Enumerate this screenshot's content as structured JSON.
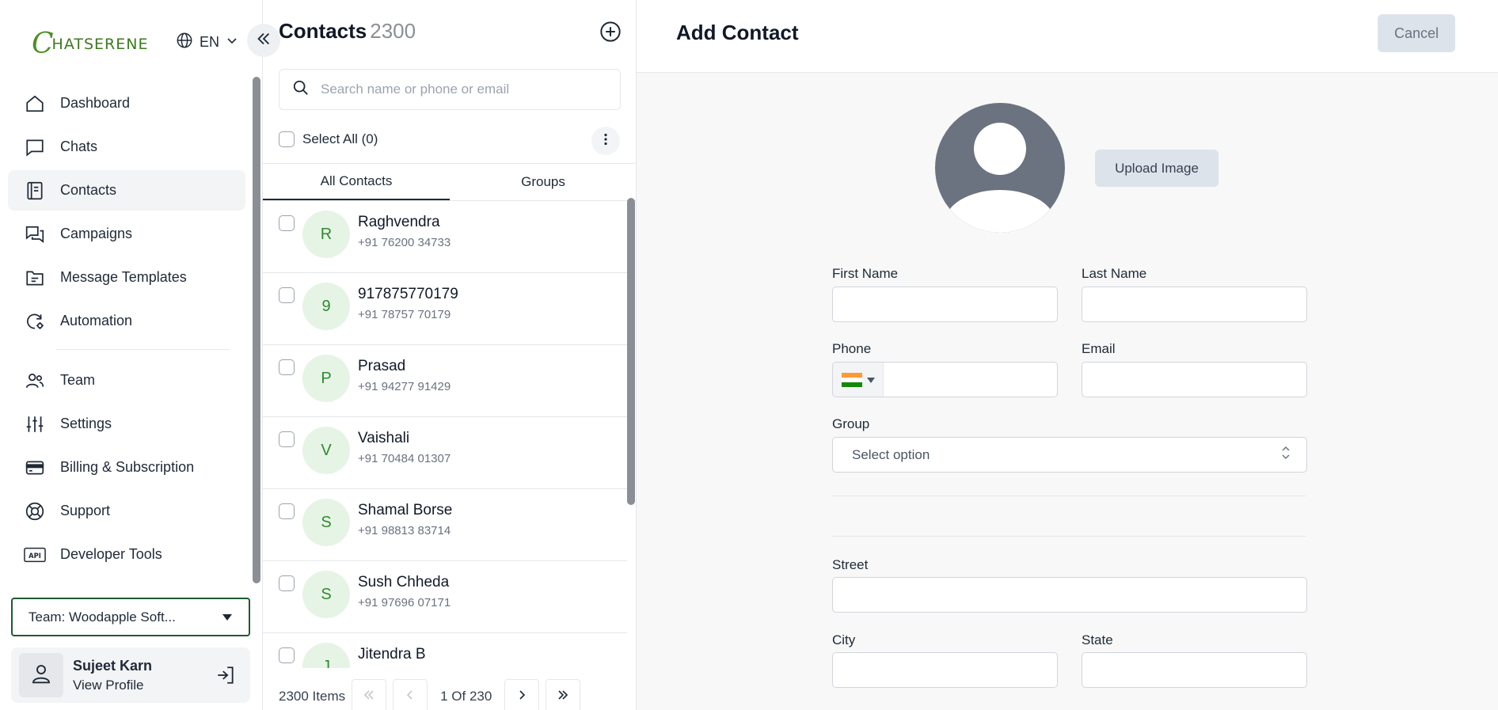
{
  "brand": {
    "logo_text": "HATSERENE",
    "logo_initial": "C",
    "accent": "#4b8f24"
  },
  "language": {
    "value": "EN"
  },
  "sidebar": {
    "items": [
      {
        "label": "Dashboard",
        "icon": "home-icon"
      },
      {
        "label": "Chats",
        "icon": "chat-icon"
      },
      {
        "label": "Contacts",
        "icon": "contacts-book-icon",
        "active": true
      },
      {
        "label": "Campaigns",
        "icon": "campaign-icon"
      },
      {
        "label": "Message Templates",
        "icon": "template-folder-icon"
      },
      {
        "label": "Automation",
        "icon": "automation-icon"
      },
      {
        "label": "Team",
        "icon": "team-icon"
      },
      {
        "label": "Settings",
        "icon": "sliders-icon"
      },
      {
        "label": "Billing & Subscription",
        "icon": "credit-card-icon"
      },
      {
        "label": "Support",
        "icon": "lifebuoy-icon"
      },
      {
        "label": "Developer Tools",
        "icon": "api-icon"
      }
    ],
    "team_select": "Team: Woodapple Soft...",
    "profile": {
      "name": "Sujeet Karn",
      "link": "View Profile"
    }
  },
  "contacts": {
    "title": "Contacts",
    "count": "2300",
    "search_placeholder": "Search name or phone or email",
    "select_all": "Select All (0)",
    "tabs": [
      "All Contacts",
      "Groups"
    ],
    "rows": [
      {
        "initial": "R",
        "name": "Raghvendra",
        "phone": "+91 76200 34733"
      },
      {
        "initial": "9",
        "name": "917875770179",
        "phone": "+91 78757 70179"
      },
      {
        "initial": "P",
        "name": "Prasad",
        "phone": "+91 94277 91429"
      },
      {
        "initial": "V",
        "name": "Vaishali",
        "phone": "+91 70484 01307"
      },
      {
        "initial": "S",
        "name": "Shamal Borse",
        "phone": "+91 98813 83714"
      },
      {
        "initial": "S",
        "name": "Sush Chheda",
        "phone": "+91 97696 07171"
      },
      {
        "initial": "J",
        "name": "Jitendra B",
        "phone": ""
      }
    ],
    "pager": {
      "items": "2300 Items",
      "page": "1 Of 230"
    }
  },
  "form": {
    "title": "Add Contact",
    "cancel": "Cancel",
    "upload": "Upload Image",
    "first_name": "First Name",
    "last_name": "Last Name",
    "phone": "Phone",
    "email": "Email",
    "group": "Group",
    "group_placeholder": "Select option",
    "street": "Street",
    "city": "City",
    "state": "State"
  }
}
